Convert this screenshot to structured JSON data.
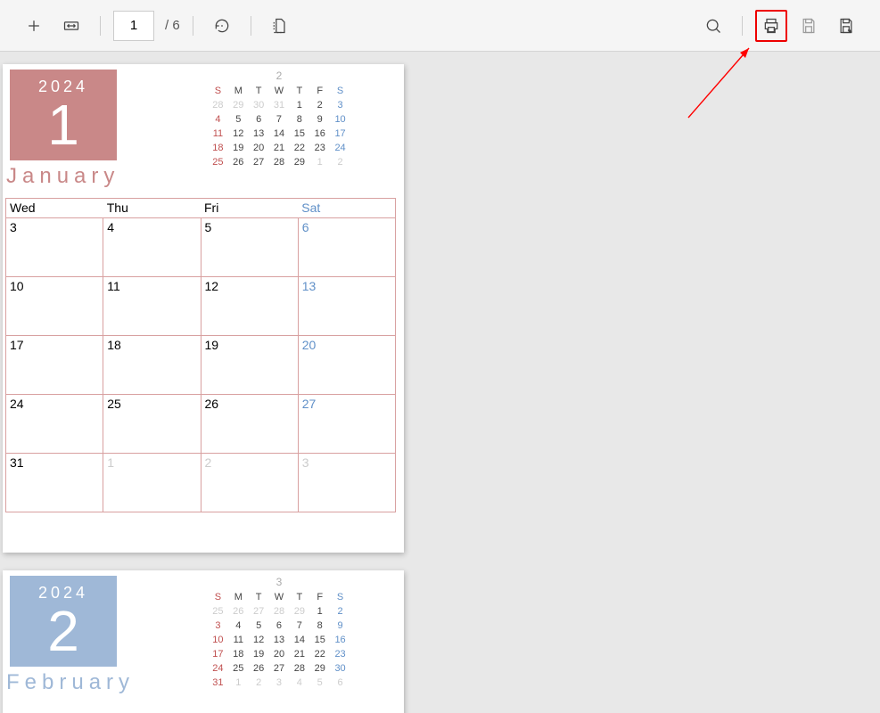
{
  "toolbar": {
    "current_page": "1",
    "total_pages": "/ 6"
  },
  "annotation": {
    "print_pointer": "arrow-pointing-to-print"
  },
  "page1": {
    "year": "2024",
    "month_number": "1",
    "month_name": "January",
    "mini_next_month": "2",
    "mini_headers": [
      "S",
      "M",
      "T",
      "W",
      "T",
      "F",
      "S"
    ],
    "mini_rows": [
      [
        "28",
        "29",
        "30",
        "31",
        "1",
        "2",
        "3"
      ],
      [
        "4",
        "5",
        "6",
        "7",
        "8",
        "9",
        "10"
      ],
      [
        "11",
        "12",
        "13",
        "14",
        "15",
        "16",
        "17"
      ],
      [
        "18",
        "19",
        "20",
        "21",
        "22",
        "23",
        "24"
      ],
      [
        "25",
        "26",
        "27",
        "28",
        "29",
        "1",
        "2"
      ]
    ],
    "big_headers": [
      "Wed",
      "Thu",
      "Fri",
      "Sat"
    ],
    "big_rows": [
      [
        "3",
        "4",
        "5",
        "6"
      ],
      [
        "10",
        "11",
        "12",
        "13"
      ],
      [
        "17",
        "18",
        "19",
        "20"
      ],
      [
        "24",
        "25",
        "26",
        "27"
      ],
      [
        "31",
        "1",
        "2",
        "3"
      ]
    ]
  },
  "page2": {
    "year": "2024",
    "month_number": "2",
    "month_name": "February",
    "mini_next_month": "3",
    "mini_headers": [
      "S",
      "M",
      "T",
      "W",
      "T",
      "F",
      "S"
    ],
    "mini_rows": [
      [
        "25",
        "26",
        "27",
        "28",
        "29",
        "1",
        "2"
      ],
      [
        "3",
        "4",
        "5",
        "6",
        "7",
        "8",
        "9"
      ],
      [
        "10",
        "11",
        "12",
        "13",
        "14",
        "15",
        "16"
      ],
      [
        "17",
        "18",
        "19",
        "20",
        "21",
        "22",
        "23"
      ],
      [
        "24",
        "25",
        "26",
        "27",
        "28",
        "29",
        "30"
      ],
      [
        "31",
        "1",
        "2",
        "3",
        "4",
        "5",
        "6"
      ]
    ]
  }
}
